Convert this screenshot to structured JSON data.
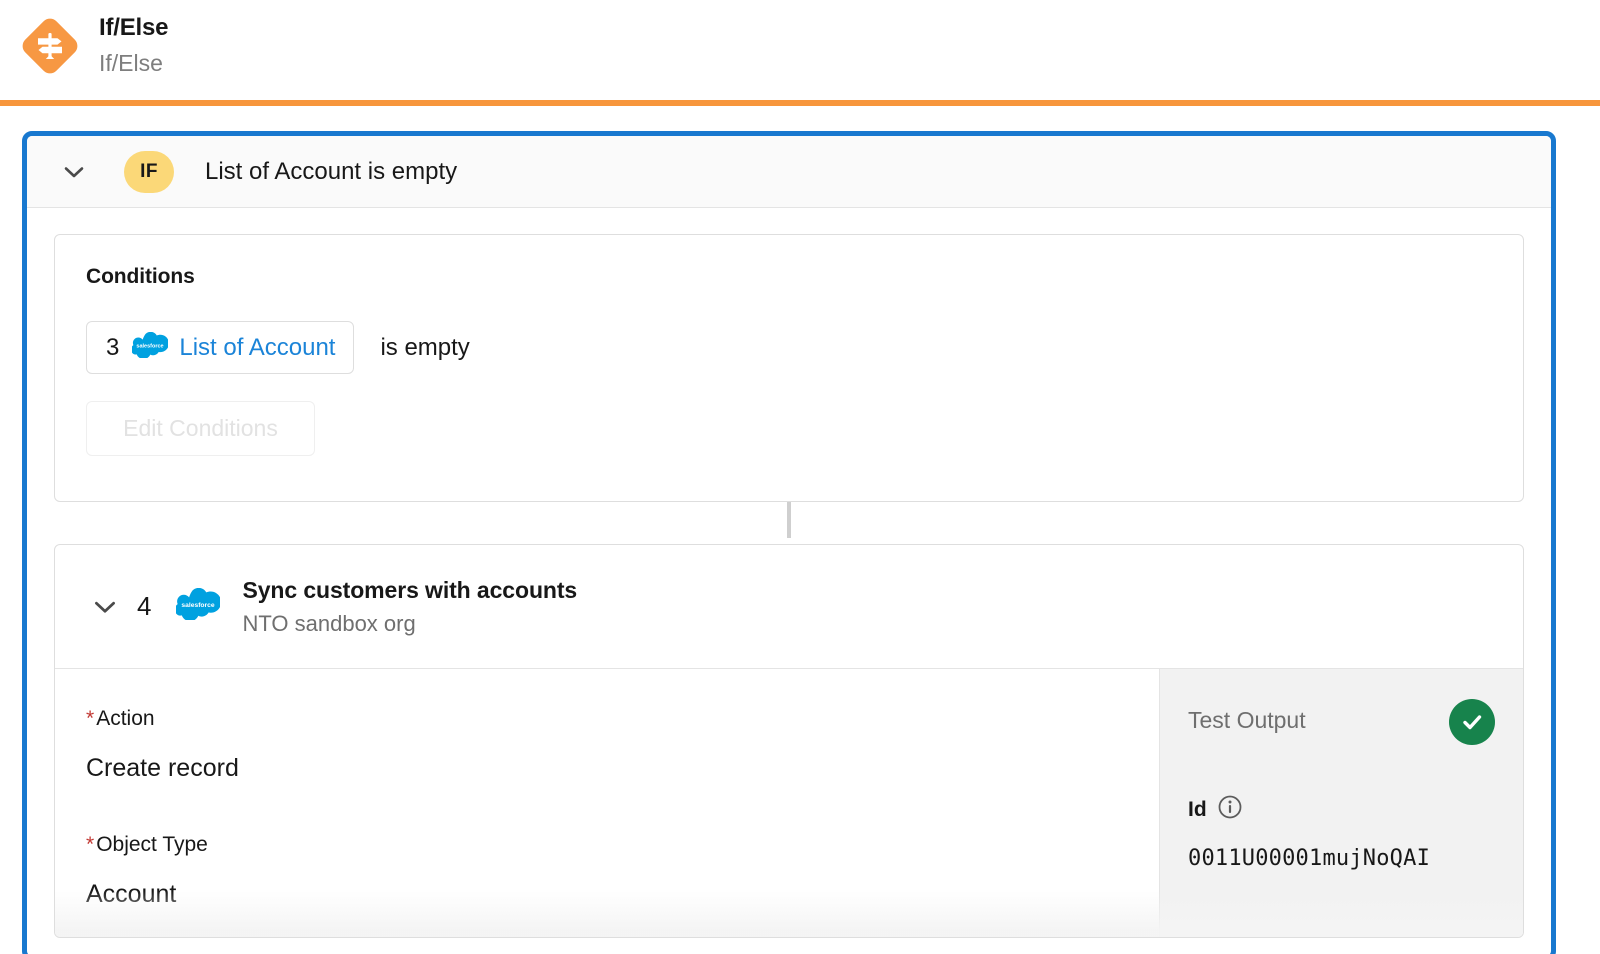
{
  "header": {
    "title": "If/Else",
    "subtitle": "If/Else",
    "icon": "if-else-signpost-icon",
    "accent_color": "#F7963C"
  },
  "panel": {
    "border_color": "#1878CF",
    "if_row": {
      "chevron": "chevron-down-icon",
      "badge": "IF",
      "badge_color": "#FBD878",
      "label": "List of Account is empty"
    },
    "conditions": {
      "title": "Conditions",
      "rows": [
        {
          "number": "3",
          "source_icon": "salesforce-cloud-icon",
          "resource": "List of Account",
          "operator": "is empty",
          "link_color": "#1B84D8"
        }
      ],
      "edit_button": "Edit Conditions",
      "edit_button_disabled": true
    },
    "step": {
      "chevron": "chevron-down-icon",
      "number": "4",
      "icon": "salesforce-cloud-icon",
      "title": "Sync customers with accounts",
      "subtitle": "NTO sandbox org",
      "fields": [
        {
          "label": "Action",
          "required": "*",
          "value": "Create record"
        },
        {
          "label": "Object Type",
          "required": "*",
          "value": "Account"
        }
      ],
      "test_output": {
        "title": "Test Output",
        "status": "success",
        "status_icon": "check-circle-icon",
        "status_color": "#17834C",
        "id_label": "Id",
        "info_icon": "info-icon",
        "id_value": "0011U00001mujNoQAI"
      }
    }
  }
}
